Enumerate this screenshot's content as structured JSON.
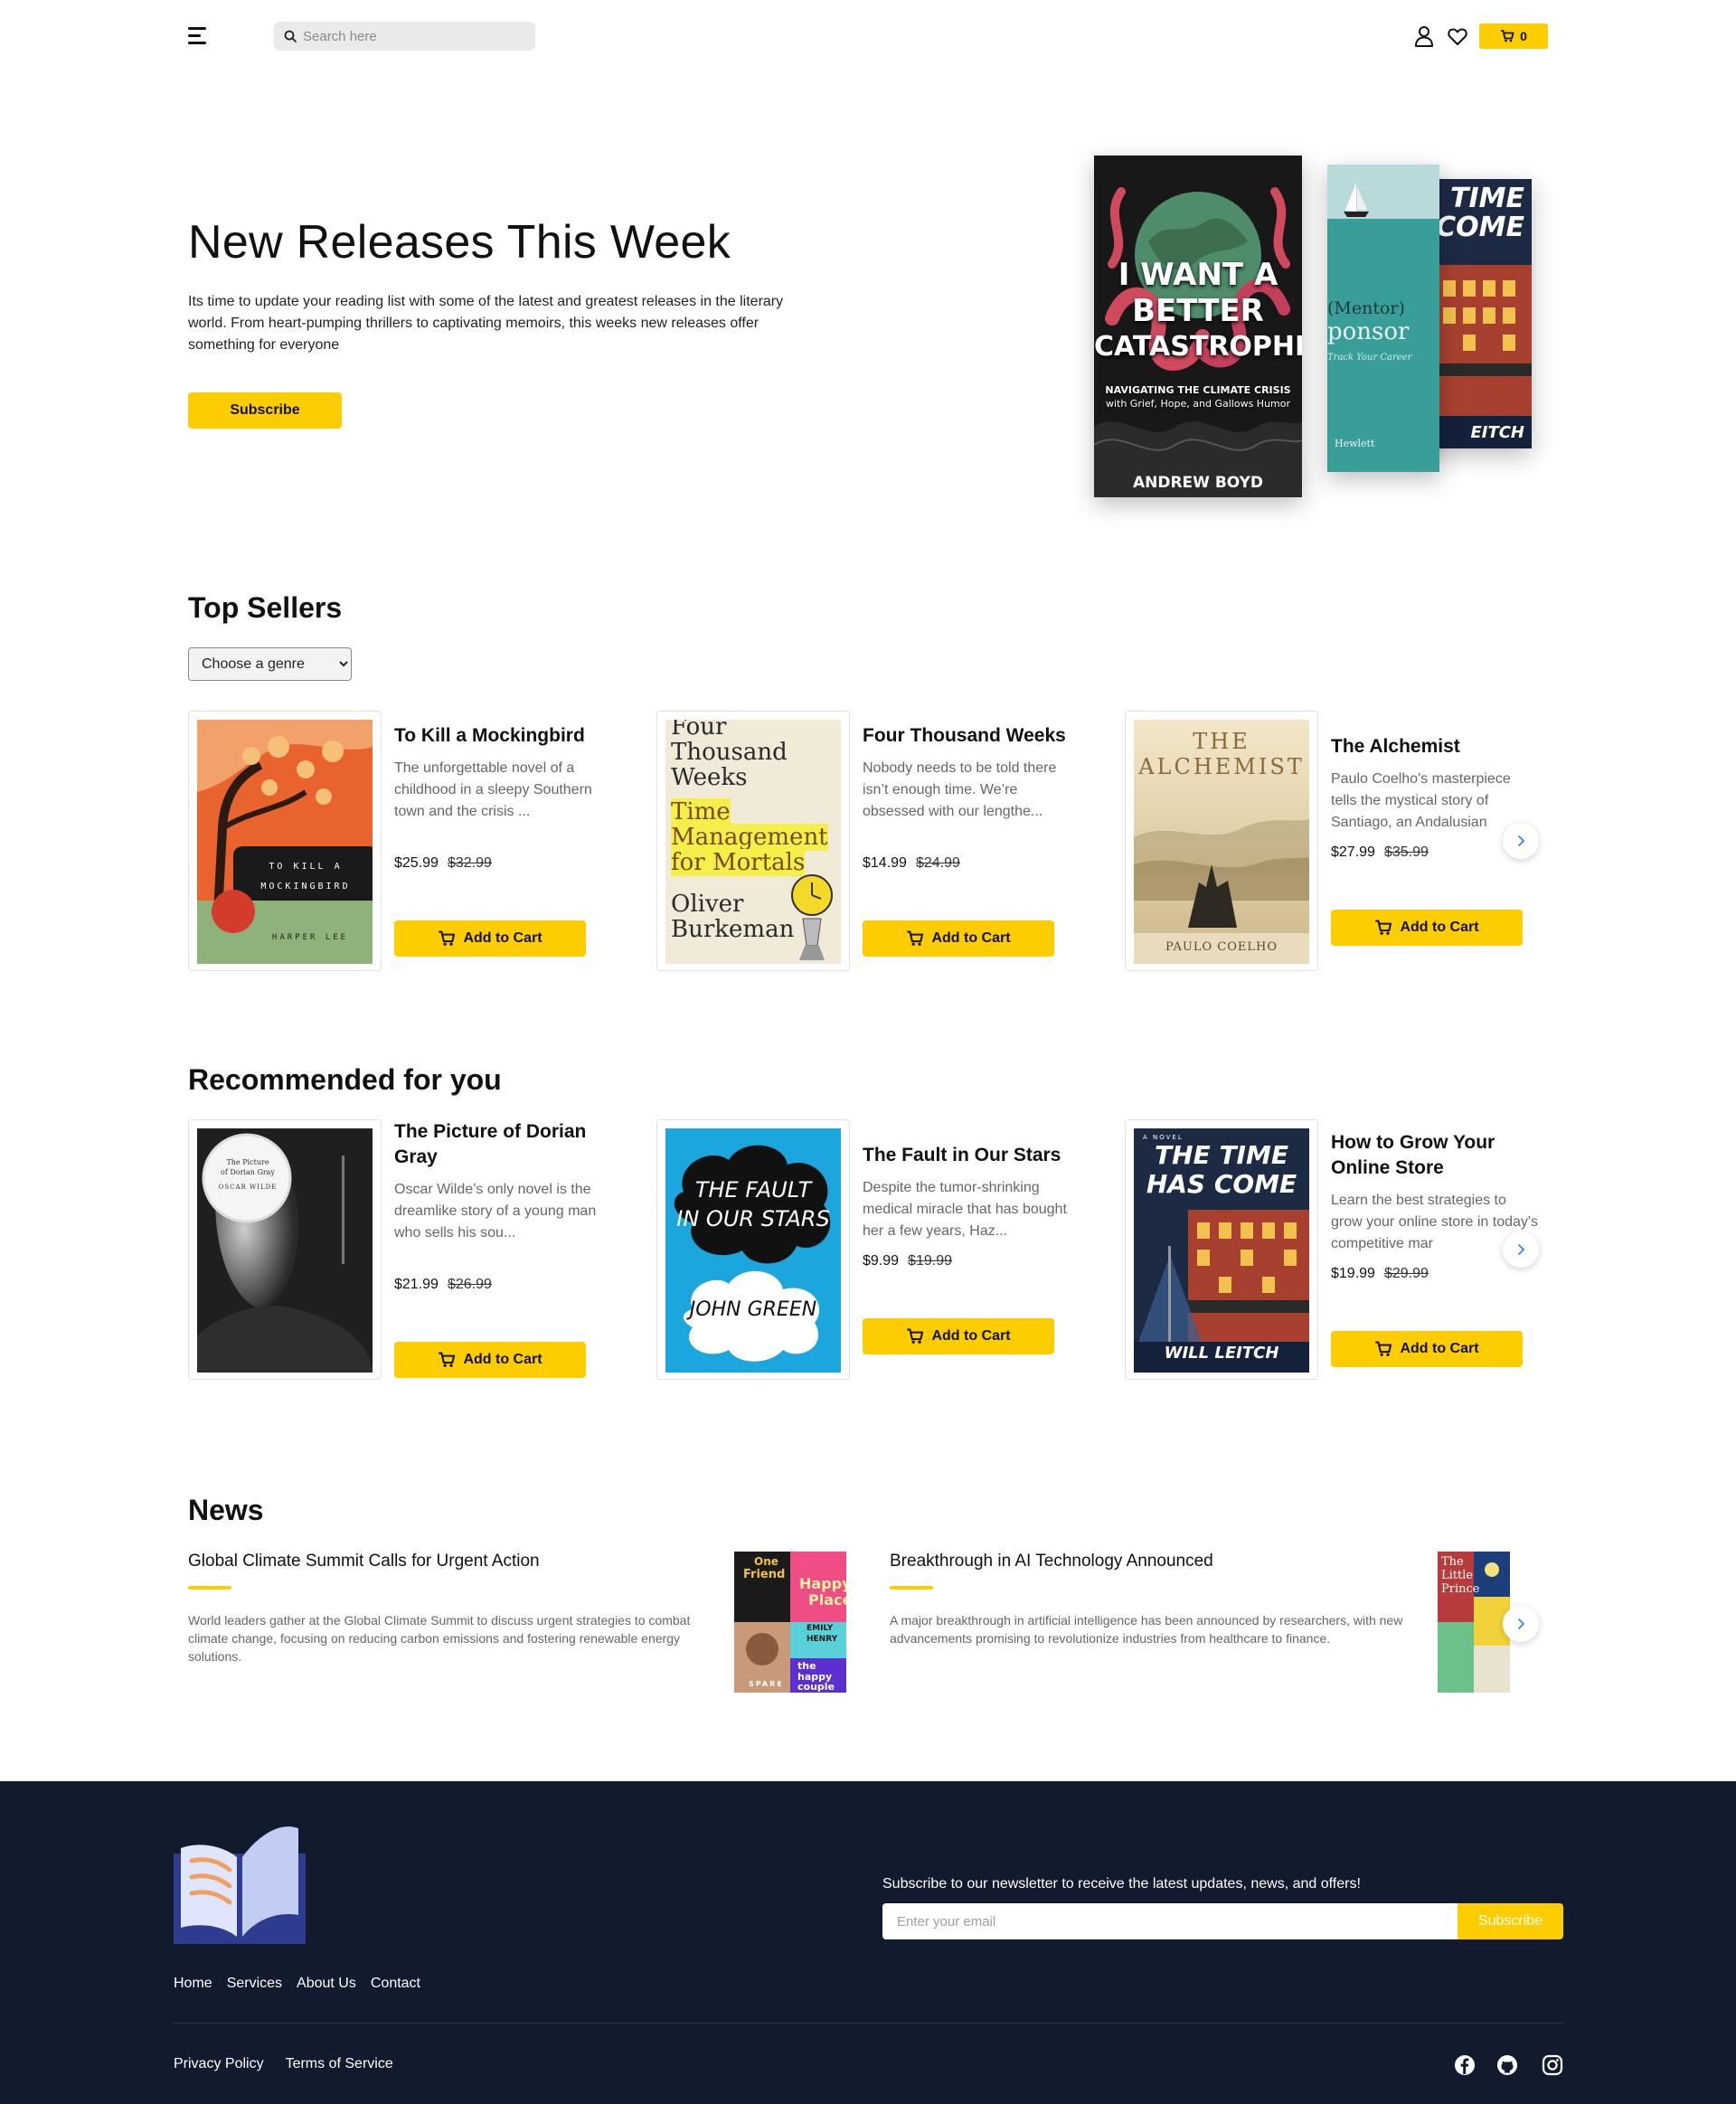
{
  "header": {
    "search_placeholder": "Search here",
    "cart_count": "0",
    "accent": "#FECD00"
  },
  "hero": {
    "title": "New Releases This Week",
    "description": "Its time to update your reading list with some of the latest and greatest releases in the literary world. From heart-pumping thrillers to captivating memoirs, this weeks new releases offer something for everyone",
    "subscribe_label": "Subscribe",
    "books": [
      {
        "cover_lines": [
          "I WANT A",
          "BETTER",
          "CATASTROPHE"
        ],
        "subtitle_lines": [
          "NAVIGATING THE CLIMATE CRISIS",
          "with Grief, Hope, and Gallows Humor"
        ],
        "author": "ANDREW BOYD"
      },
      {
        "cover_lines": [
          "(Mentor)",
          "ponsor"
        ],
        "subtitle_lines": [
          "Track Your Career"
        ],
        "author": "Hewlett"
      },
      {
        "cover_lines": [
          "TIME",
          "COME"
        ],
        "subtitle_lines": [],
        "author": "EITCH"
      }
    ]
  },
  "top_sellers": {
    "title": "Top Sellers",
    "genre_select": {
      "selected": "Choose a genre",
      "options": [
        "Choose a genre"
      ]
    },
    "books": [
      {
        "title": "To Kill a Mockingbird",
        "description": "The unforgettable novel of a childhood in a sleepy Southern town and the crisis ...",
        "price": "$25.99",
        "old_price": "$32.99",
        "cart_label": "Add to Cart",
        "cover_text": [
          "TO KILL A",
          "MOCKINGBIRD",
          "HARPER LEE"
        ]
      },
      {
        "title": "Four Thousand Weeks",
        "description": "Nobody needs to be told there isn’t enough time. We’re obsessed with our lengthe...",
        "price": "$14.99",
        "old_price": "$24.99",
        "cart_label": "Add to Cart",
        "cover_text": [
          "Four",
          "Thousand",
          "Weeks",
          "Time",
          "Management",
          "for Mortals",
          "Oliver",
          "Burkeman"
        ]
      },
      {
        "title": "The Alchemist",
        "description": "Paulo Coelho's masterpiece tells the mystical story of Santiago, an Andalusian",
        "price": "$27.99",
        "old_price": "$35.99",
        "cart_label": "Add to Cart",
        "cover_text": [
          "THE",
          "ALCHEMIST",
          "PAULO COELHO"
        ]
      }
    ]
  },
  "recommended": {
    "title": "Recommended for you",
    "books": [
      {
        "title": "The Picture of Dorian Gray",
        "description": "Oscar Wilde’s only novel is the dreamlike story of a young man who sells his sou...",
        "price": "$21.99",
        "old_price": "$26.99",
        "cart_label": "Add to Cart",
        "cover_text": [
          "The Picture",
          "of Dorian Gray",
          "OSCAR WILDE"
        ]
      },
      {
        "title": "The Fault in Our Stars",
        "description": "Despite the tumor-shrinking medical miracle that has bought her a few years, Haz...",
        "price": "$9.99",
        "old_price": "$19.99",
        "cart_label": "Add to Cart",
        "cover_text": [
          "THE FAULT",
          "IN OUR STARS",
          "JOHN GREEN"
        ]
      },
      {
        "title": "How to Grow Your Online Store",
        "description": "Learn the best strategies to grow your online store in today's competitive mar",
        "price": "$19.99",
        "old_price": "$29.99",
        "cart_label": "Add to Cart",
        "cover_text": [
          "A NOVEL",
          "THE TIME",
          "HAS COME",
          "WILL LEITCH"
        ]
      }
    ]
  },
  "news": {
    "title": "News",
    "items": [
      {
        "title": "Global Climate Summit Calls for Urgent Action",
        "description": "World leaders gather at the Global Climate Summit to discuss urgent strategies to combat climate change, focusing on reducing carbon emissions and fostering renewable energy solutions.",
        "image_text": [
          "One",
          "Friend",
          "Happy",
          "Place",
          "EMILY",
          "HENRY",
          "SPARE",
          "the",
          "happy",
          "couple"
        ]
      },
      {
        "title": "Breakthrough in AI Technology Announced",
        "description": "A major breakthrough in artificial intelligence has been announced by researchers, with new advancements promising to revolutionize industries from healthcare to finance.",
        "image_text": [
          "The",
          "Little",
          "Prince"
        ]
      }
    ]
  },
  "footer": {
    "links": [
      "Home",
      "Services",
      "About Us",
      "Contact"
    ],
    "newsletter_text": "Subscribe to our newsletter to receive the latest updates, news, and offers!",
    "email_placeholder": "Enter your email",
    "subscribe_label": "Subscribe",
    "legal": [
      "Privacy Policy",
      "Terms of Service"
    ],
    "social_icons": [
      "facebook-icon",
      "github-icon",
      "instagram-icon"
    ],
    "background": "#121a2e"
  }
}
